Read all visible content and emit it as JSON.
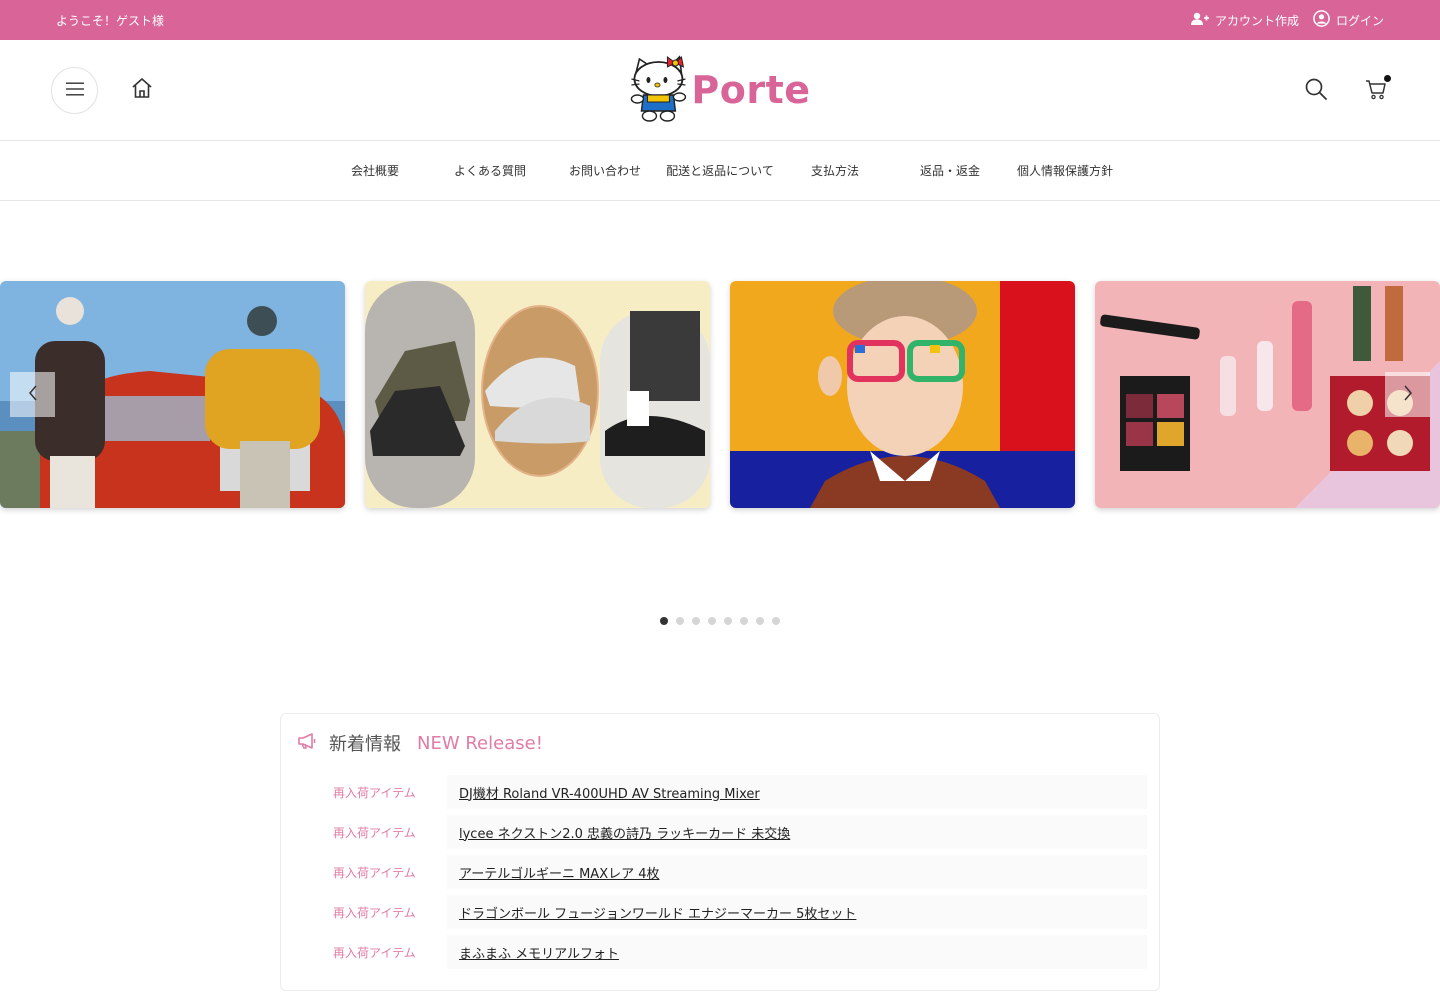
{
  "topbar": {
    "welcome": "ようこそ！ゲスト様",
    "create_account": "アカウント作成",
    "login": "ログイン",
    "bg_color": "#d96598"
  },
  "header": {
    "logo_text": "Porte",
    "brand_color": "#d96598"
  },
  "nav": {
    "items": [
      "会社概要",
      "よくある質問",
      "お問い合わせ",
      "配送と返品について",
      "支払方法",
      "返品・返金",
      "個人情報保護方針"
    ]
  },
  "carousel": {
    "slide_count": 8,
    "active_index": 0,
    "prev_icon": "chevron-left-icon",
    "next_icon": "chevron-right-icon"
  },
  "news": {
    "title": "新着情報",
    "subtitle": "NEW Release!",
    "accent_color": "#e07ca5",
    "items": [
      {
        "category": "再入荷アイテム",
        "title": "DJ機材 Roland VR-400UHD AV Streaming Mixer"
      },
      {
        "category": "再入荷アイテム",
        "title": "lycee ネクストン2.0 忠義の詩乃 ラッキーカード 未交換"
      },
      {
        "category": "再入荷アイテム",
        "title": "アーテルゴルギーニ MAXレア 4枚"
      },
      {
        "category": "再入荷アイテム",
        "title": "ドラゴンボール フュージョンワールド エナジーマーカー 5枚セット"
      },
      {
        "category": "再入荷アイテム",
        "title": "まふまふ メモリアルフォト"
      }
    ]
  }
}
